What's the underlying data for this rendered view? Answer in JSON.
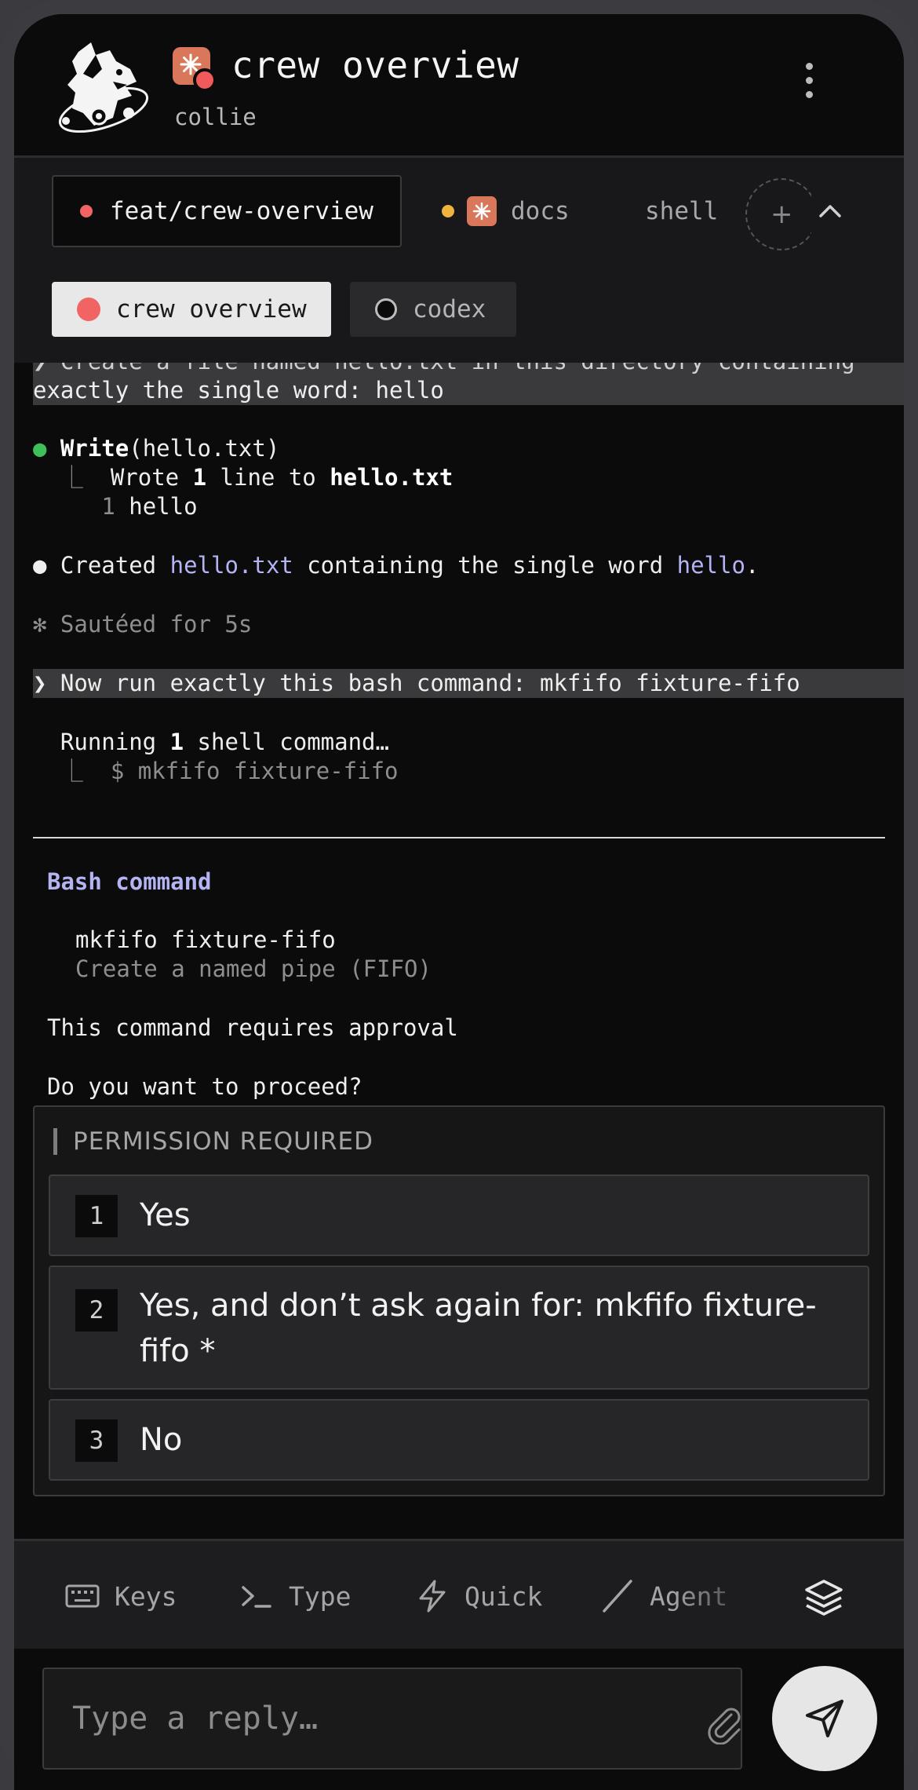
{
  "header": {
    "title": "crew overview",
    "subtitle": "collie",
    "logo_icon": "collie-dog-logo-icon",
    "badge_color": "#d8775a",
    "status_dot_color": "#f15a5a"
  },
  "tabs": [
    {
      "label": "feat/crew-overview",
      "dot_color": "#f26464",
      "active": true
    },
    {
      "label": "docs",
      "dot_color": "#f0b43c",
      "active": false
    },
    {
      "label": "shell",
      "active": false
    }
  ],
  "sessions": [
    {
      "label": "crew overview",
      "active": true,
      "dot_color": "#f26464"
    },
    {
      "label": "codex",
      "active": false
    }
  ],
  "terminal": {
    "prompt_cut": "❯ Create a file named hello.txt in this directory containing",
    "prompt_cont": "exactly the single word: hello",
    "write_tool": "Write",
    "write_arg": "(hello.txt)",
    "write_result_pre": "Wrote ",
    "write_result_num": "1",
    "write_result_mid": " line to ",
    "write_result_file": "hello.txt",
    "file_line_no": "1",
    "file_line_text": "hello",
    "created_pre": "Created ",
    "created_file": "hello.txt",
    "created_mid": " containing the single word ",
    "created_word": "hello",
    "created_end": ".",
    "status": "✻ Sautéed for 5s",
    "prompt2": "❯ Now run exactly this bash command: mkfifo fixture-fifo",
    "running_pre": "Running ",
    "running_num": "1",
    "running_post": " shell command…",
    "running_cmd": "$ mkfifo fixture-fifo",
    "bash_title": "Bash command",
    "bash_cmd": "mkfifo fixture-fifo",
    "bash_desc": "Create a named pipe (FIFO)",
    "approval": "This command requires approval",
    "proceed": "Do you want to proceed?"
  },
  "permission": {
    "heading": "PERMISSION REQUIRED",
    "options": [
      {
        "num": "1",
        "label": "Yes"
      },
      {
        "num": "2",
        "label": "Yes, and don’t ask again for: mkfifo fixture-fifo *"
      },
      {
        "num": "3",
        "label": "No"
      }
    ]
  },
  "toolbar": {
    "keys": "Keys",
    "type": "Type",
    "quick": "Quick",
    "agent": "Agent"
  },
  "input": {
    "placeholder": "Type a reply…"
  }
}
